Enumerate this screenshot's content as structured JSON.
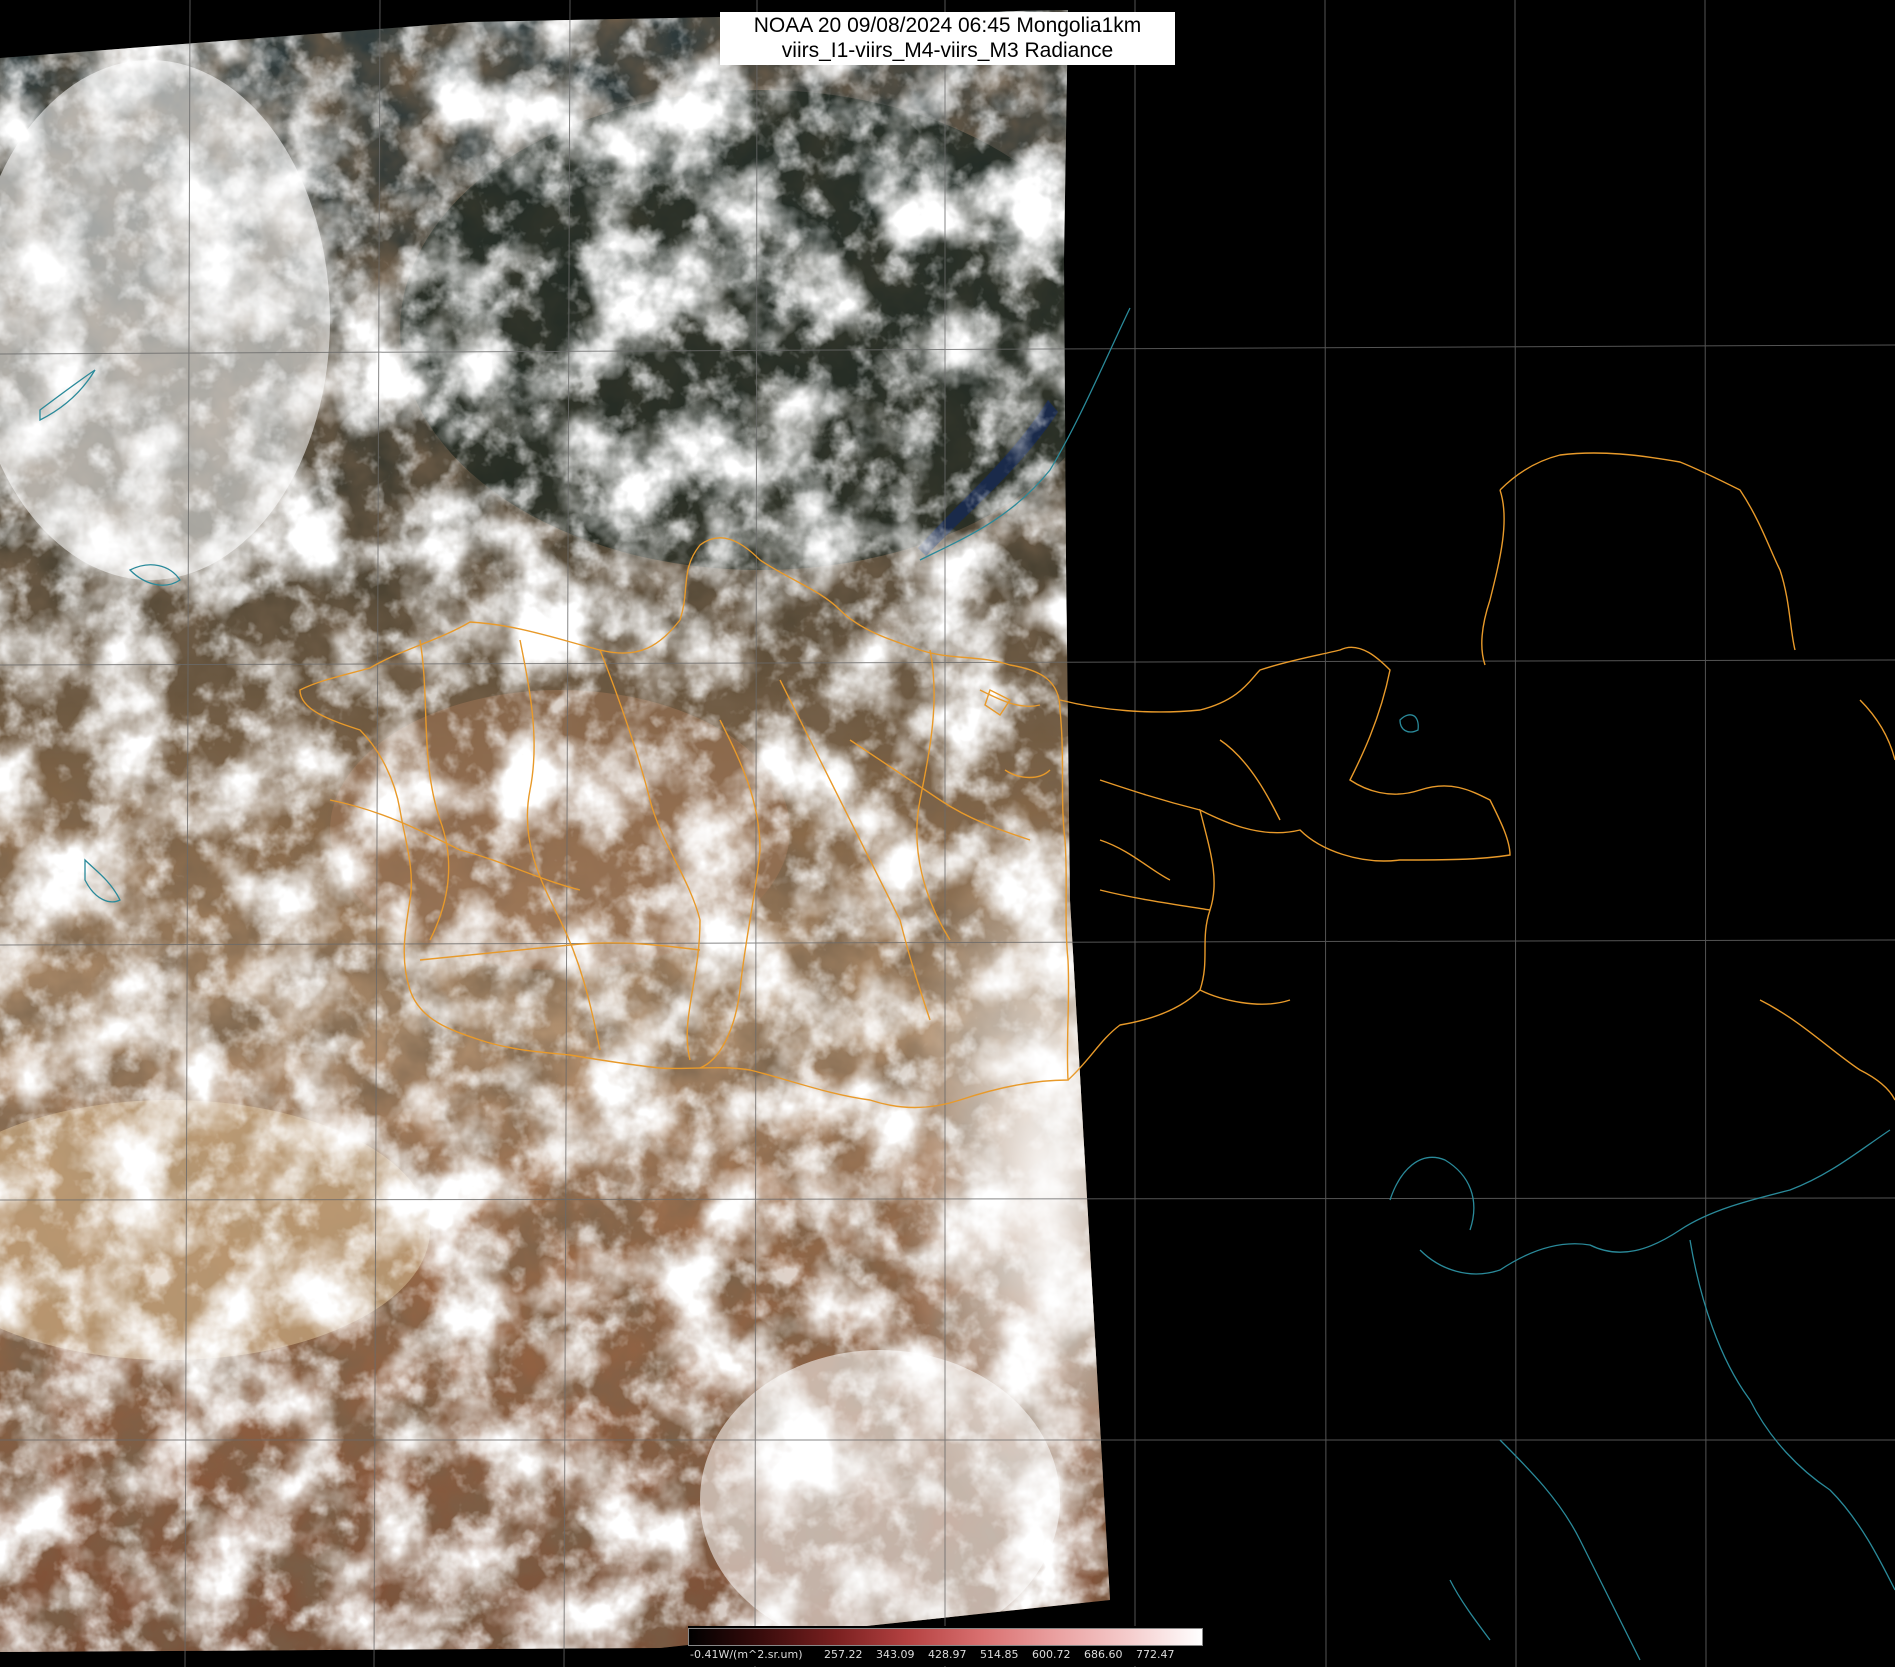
{
  "header": {
    "line1": "NOAA 20 09/08/2024 06:45 Mongolia1km",
    "line2": "viirs_I1-viirs_M4-viirs_M3 Radiance"
  },
  "legend": {
    "labels": [
      "-0.41W/(m^2.sr.um)",
      "257.22",
      "343.09",
      "428.97",
      "514.85",
      "600.72",
      "686.60",
      "772.47"
    ],
    "colors": [
      "#000000",
      "#3a0c0c",
      "#7a2020",
      "#b54242",
      "#d97070",
      "#eaa0a0",
      "#f5cccc",
      "#ffffff"
    ]
  },
  "colors": {
    "border": "#e89a2a",
    "coast": "#2a8a9a",
    "grid": "#6a6a6a"
  }
}
